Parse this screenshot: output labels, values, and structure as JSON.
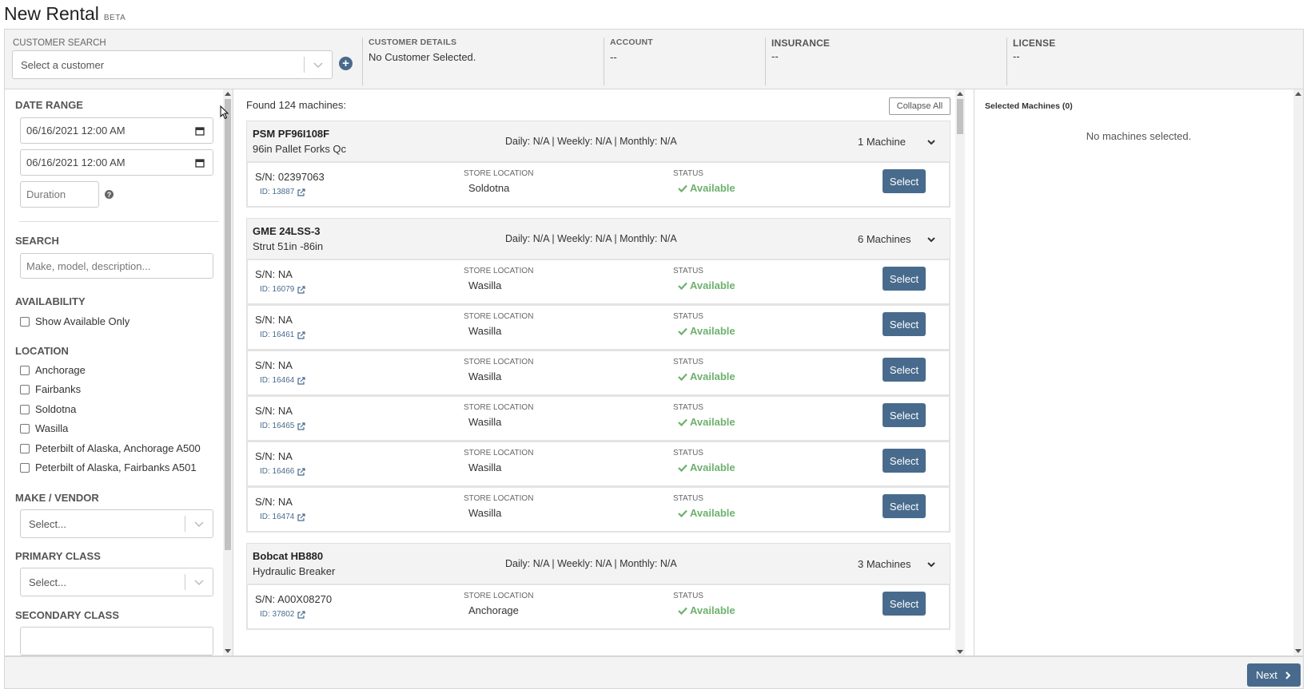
{
  "page": {
    "title": "New Rental",
    "badge": "BETA"
  },
  "topbar": {
    "customer_search_label": "CUSTOMER SEARCH",
    "customer_placeholder": "Select a customer",
    "customer_details_label": "CUSTOMER DETAILS",
    "customer_details_value": "No Customer Selected.",
    "account_label": "ACCOUNT",
    "account_value": "--",
    "insurance_label": "INSURANCE",
    "insurance_value": "--",
    "license_label": "LICENSE",
    "license_value": "--"
  },
  "filters": {
    "date_range_title": "DATE RANGE",
    "start": "06/16/2021 12:00 AM",
    "end": "06/16/2021 12:00 AM",
    "duration_placeholder": "Duration",
    "search_title": "SEARCH",
    "search_placeholder": "Make, model, description...",
    "availability_title": "AVAILABILITY",
    "show_available": "Show Available Only",
    "location_title": "LOCATION",
    "locations": [
      "Anchorage",
      "Fairbanks",
      "Soldotna",
      "Wasilla",
      "Peterbilt of Alaska, Anchorage A500",
      "Peterbilt of Alaska, Fairbanks A501"
    ],
    "make_title": "MAKE / VENDOR",
    "make_placeholder": "Select...",
    "primary_title": "PRIMARY CLASS",
    "primary_placeholder": "Select...",
    "secondary_title": "SECONDARY CLASS"
  },
  "results": {
    "found": "Found 124 machines:",
    "collapse_all": "Collapse All",
    "store_location_label": "STORE LOCATION",
    "status_label": "STATUS",
    "select_label": "Select",
    "groups": [
      {
        "name": "PSM PF96I108F",
        "desc": "96in Pallet Forks Qc",
        "rates": "Daily: N/A | Weekly: N/A | Monthly: N/A",
        "count": "1 Machine",
        "machines": [
          {
            "sn": "S/N: 02397063",
            "id": "ID: 13887",
            "location": "Soldotna",
            "status": "Available"
          }
        ]
      },
      {
        "name": "GME 24LSS-3",
        "desc": "Strut 51in -86in",
        "rates": "Daily: N/A | Weekly: N/A | Monthly: N/A",
        "count": "6 Machines",
        "machines": [
          {
            "sn": "S/N: NA",
            "id": "ID: 16079",
            "location": "Wasilla",
            "status": "Available"
          },
          {
            "sn": "S/N: NA",
            "id": "ID: 16461",
            "location": "Wasilla",
            "status": "Available"
          },
          {
            "sn": "S/N: NA",
            "id": "ID: 16464",
            "location": "Wasilla",
            "status": "Available"
          },
          {
            "sn": "S/N: NA",
            "id": "ID: 16465",
            "location": "Wasilla",
            "status": "Available"
          },
          {
            "sn": "S/N: NA",
            "id": "ID: 16466",
            "location": "Wasilla",
            "status": "Available"
          },
          {
            "sn": "S/N: NA",
            "id": "ID: 16474",
            "location": "Wasilla",
            "status": "Available"
          }
        ]
      },
      {
        "name": "Bobcat HB880",
        "desc": "Hydraulic Breaker",
        "rates": "Daily: N/A | Weekly: N/A | Monthly: N/A",
        "count": "3 Machines",
        "machines": [
          {
            "sn": "S/N: A00X08270",
            "id": "ID: 37802",
            "location": "Anchorage",
            "status": "Available"
          }
        ]
      }
    ]
  },
  "selected": {
    "title": "Selected Machines (0)",
    "empty": "No machines selected."
  },
  "footer": {
    "next": "Next"
  },
  "colors": {
    "accent": "#486b8d",
    "available": "#6db16d",
    "panel": "#f3f3f3"
  }
}
